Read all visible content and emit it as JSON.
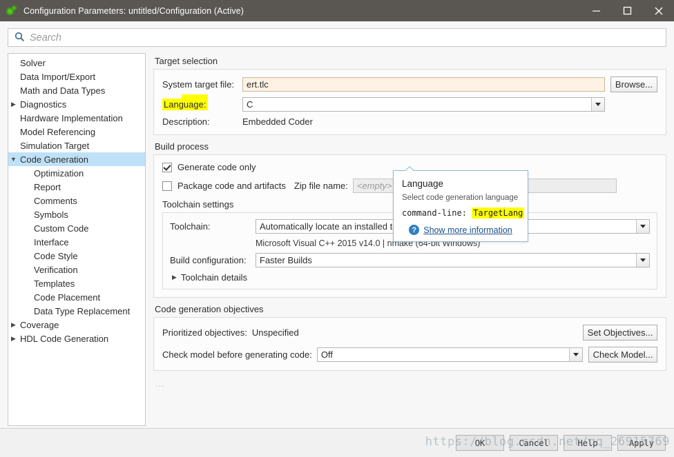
{
  "window": {
    "title": "Configuration Parameters: untitled/Configuration (Active)",
    "app_icon": "simulink-icon",
    "minimize_label": "minimize-icon",
    "maximize_label": "maximize-icon",
    "close_label": "close-icon"
  },
  "search": {
    "placeholder": "Search",
    "value": "",
    "icon": "search-icon"
  },
  "sidebar": {
    "items": [
      {
        "label": "Solver",
        "indent": 0,
        "arrow": "",
        "selected": false
      },
      {
        "label": "Data Import/Export",
        "indent": 0,
        "arrow": "",
        "selected": false
      },
      {
        "label": "Math and Data Types",
        "indent": 0,
        "arrow": "",
        "selected": false
      },
      {
        "label": "Diagnostics",
        "indent": 0,
        "arrow": "▶",
        "selected": false
      },
      {
        "label": "Hardware Implementation",
        "indent": 0,
        "arrow": "",
        "selected": false
      },
      {
        "label": "Model Referencing",
        "indent": 0,
        "arrow": "",
        "selected": false
      },
      {
        "label": "Simulation Target",
        "indent": 0,
        "arrow": "",
        "selected": false
      },
      {
        "label": "Code Generation",
        "indent": 0,
        "arrow": "▼",
        "selected": true
      },
      {
        "label": "Optimization",
        "indent": 1,
        "arrow": "",
        "selected": false
      },
      {
        "label": "Report",
        "indent": 1,
        "arrow": "",
        "selected": false
      },
      {
        "label": "Comments",
        "indent": 1,
        "arrow": "",
        "selected": false
      },
      {
        "label": "Symbols",
        "indent": 1,
        "arrow": "",
        "selected": false
      },
      {
        "label": "Custom Code",
        "indent": 1,
        "arrow": "",
        "selected": false
      },
      {
        "label": "Interface",
        "indent": 1,
        "arrow": "",
        "selected": false
      },
      {
        "label": "Code Style",
        "indent": 1,
        "arrow": "",
        "selected": false
      },
      {
        "label": "Verification",
        "indent": 1,
        "arrow": "",
        "selected": false
      },
      {
        "label": "Templates",
        "indent": 1,
        "arrow": "",
        "selected": false
      },
      {
        "label": "Code Placement",
        "indent": 1,
        "arrow": "",
        "selected": false
      },
      {
        "label": "Data Type Replacement",
        "indent": 1,
        "arrow": "",
        "selected": false
      },
      {
        "label": "Coverage",
        "indent": 0,
        "arrow": "▶",
        "selected": false
      },
      {
        "label": "HDL Code Generation",
        "indent": 0,
        "arrow": "▶",
        "selected": false
      }
    ]
  },
  "target_selection": {
    "group_title": "Target selection",
    "system_target_file_label": "System target file:",
    "system_target_file_value": "ert.tlc",
    "browse_label": "Browse...",
    "language_label": "Language:",
    "language_value": "C",
    "description_label": "Description:",
    "description_value": "Embedded Coder"
  },
  "build_process": {
    "group_title": "Build process",
    "generate_code_label": "Generate code only",
    "generate_code_checked": true,
    "package_code_label": "Package code and artifacts",
    "package_code_checked": false,
    "zip_file_label": "Zip file name:",
    "zip_file_placeholder": "<empty>",
    "toolchain_settings_title": "Toolchain settings",
    "toolchain_label": "Toolchain:",
    "toolchain_value": "Automatically locate an installed toolchain",
    "toolchain_detail": "Microsoft Visual C++ 2015 v14.0 | nmake (64-bit Windows)",
    "build_configuration_label": "Build configuration:",
    "build_configuration_value": "Faster Builds",
    "toolchain_details_label": "Toolchain details"
  },
  "code_gen_objectives": {
    "group_title": "Code generation objectives",
    "prioritized_label": "Prioritized objectives:",
    "prioritized_value": "Unspecified",
    "set_objectives_label": "Set Objectives...",
    "check_model_label": "Check model before generating code:",
    "check_model_value": "Off",
    "check_model_button": "Check Model...",
    "ellipsis": "..."
  },
  "tooltip": {
    "title": "Language",
    "description": "Select code generation language",
    "command_line_prefix": "command-line:",
    "command_line_value": "TargetLang",
    "help_icon": "question-mark-icon",
    "link_label": "Show more information"
  },
  "footer": {
    "ok_label": "OK",
    "cancel_label": "Cancel",
    "help_label": "Help",
    "apply_label": "Apply"
  },
  "watermark": {
    "text": "https://blog.csdn.net/qq_26915769"
  },
  "colors": {
    "titlebar": "#5a5753",
    "selection": "#bfe1f7",
    "highlight": "#ffff00",
    "modified_field": "#fdf2e3",
    "link": "#1c4f8c",
    "help_badge": "#2f7fc1"
  }
}
